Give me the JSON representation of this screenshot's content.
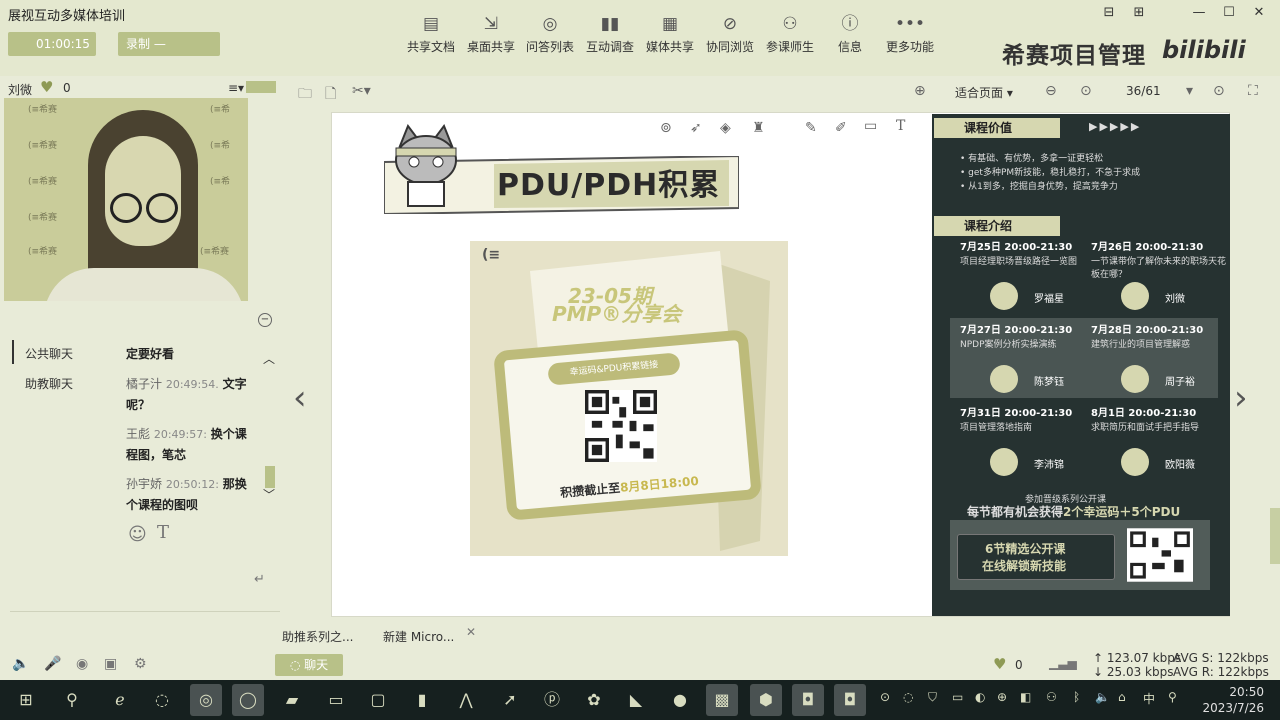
{
  "app": {
    "title": "展视互动多媒体培训"
  },
  "window_controls": {
    "restore": "⊟",
    "skin": "⊞",
    "minimize": "—",
    "maximize": "☐",
    "close": "✕"
  },
  "timer": {
    "value": "01:00:15"
  },
  "record": {
    "label": "录制",
    "value": "—"
  },
  "toolbar": {
    "items": [
      {
        "label": "共享文档",
        "icon": "document-icon"
      },
      {
        "label": "桌面共享",
        "icon": "desktop-share-icon"
      },
      {
        "label": "问答列表",
        "icon": "qa-icon"
      },
      {
        "label": "互动调查",
        "icon": "survey-icon"
      },
      {
        "label": "媒体共享",
        "icon": "media-icon"
      },
      {
        "label": "协同浏览",
        "icon": "browse-icon"
      },
      {
        "label": "参课师生",
        "icon": "users-icon"
      },
      {
        "label": "信息",
        "icon": "info-icon"
      },
      {
        "label": "更多功能",
        "icon": "more-icon"
      }
    ],
    "brand": "希赛项目管理",
    "bilibili": "bilibili"
  },
  "user": {
    "name": "刘微",
    "likes": "0"
  },
  "chat": {
    "tabs": [
      "公共聊天",
      "助教聊天"
    ],
    "messages": [
      {
        "text": "定要好看"
      },
      {
        "user": "橘子汁",
        "time": "20:49:54.",
        "text": "文字呢？"
      },
      {
        "user": "王彪",
        "time": "20:49:57:",
        "text": "换个课程图，笔芯"
      },
      {
        "user": "孙宇娇",
        "time": "20:50:12:",
        "text": "那换个课程的图呗"
      }
    ]
  },
  "doc": {
    "zoom": "适合页面",
    "page": "36/61"
  },
  "slide": {
    "title": "PDU/PDH积累",
    "poster": {
      "label": "(≡",
      "line1": "23-05期",
      "line2": "PMP®分享会",
      "pill": "幸运码&PDU积累链接",
      "deadline_prefix": "积攒截止至",
      "deadline_date": "8月8日18:00"
    },
    "panel": {
      "value_tag": "课程价值",
      "value_arrows": "▶▶▶▶▶",
      "bullets": [
        "• 有基础、有优势，多拿一证更轻松",
        "• get多种PM新技能，稳扎稳打，不急于求成",
        "• 从1到多，挖掘自身优势，提高竞争力"
      ],
      "intro_tag": "课程介绍",
      "courses": [
        {
          "time": "7月25日 20:00-21:30",
          "desc": "项目经理职场晋级路径一览图",
          "teacher": "罗福星"
        },
        {
          "time": "7月26日 20:00-21:30",
          "desc": "一节课带你了解你未来的职场天花板在哪？",
          "teacher": "刘微"
        },
        {
          "time": "7月27日 20:00-21:30",
          "desc": "NPDP案例分析实操演练",
          "teacher": "陈梦钰"
        },
        {
          "time": "7月28日 20:00-21:30",
          "desc": "建筑行业的项目管理解惑",
          "teacher": "周子裕"
        },
        {
          "time": "7月31日 20:00-21:30",
          "desc": "项目管理落地指南",
          "teacher": "李沛锦"
        },
        {
          "time": "8月1日 20:00-21:30",
          "desc": "求职简历和面试手把手指导",
          "teacher": "欧阳薇"
        }
      ],
      "promo_line1": "参加晋级系列公开课",
      "promo_line2_a": "每节都有机会获得",
      "promo_line2_b": "2个幸运码＋5个PDU",
      "bottom_l1": "6节精选公开课",
      "bottom_l2": "在线解锁新技能"
    }
  },
  "files": [
    "助推系列之...",
    "新建 Micro..."
  ],
  "footer": {
    "chat_btn": "聊天",
    "likes": "0",
    "net_s": "123.07 kbps",
    "net_r": "25.03 kbps",
    "avg_s": "AVG S: 122kbps",
    "avg_r": "AVG R: 122kbps"
  },
  "taskbar": {
    "time": "20:50",
    "date": "2023/7/26",
    "ime": "中"
  }
}
